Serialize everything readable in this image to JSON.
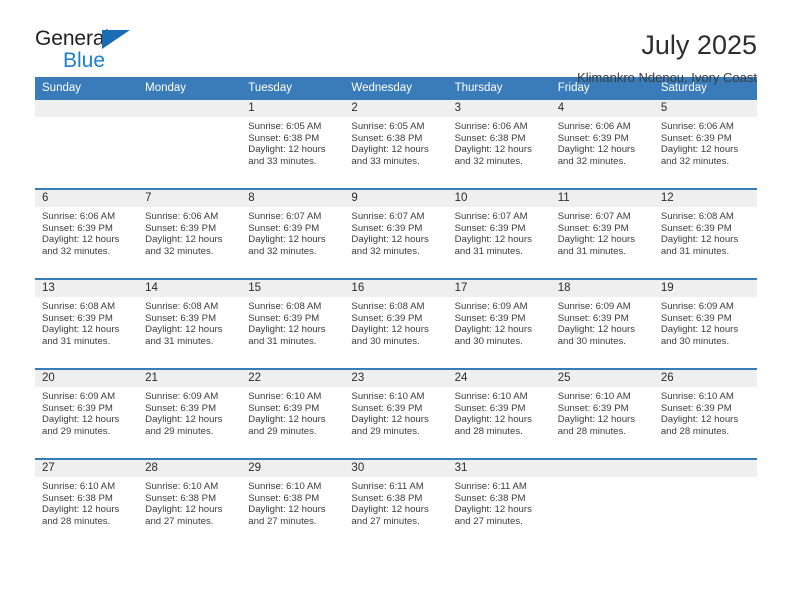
{
  "brand": {
    "name_top": "General",
    "name_bottom": "Blue",
    "accent_color": "#1b7fd4",
    "triangle_color": "#1b6cb5"
  },
  "header": {
    "title": "July 2025",
    "subtitle": "Klimankro Ndenou, Ivory Coast"
  },
  "calendar": {
    "header_bg": "#3a7cba",
    "daynum_bg": "#efefef",
    "weekdays": [
      "Sunday",
      "Monday",
      "Tuesday",
      "Wednesday",
      "Thursday",
      "Friday",
      "Saturday"
    ],
    "weeks": [
      [
        {
          "day": "",
          "sunrise": "",
          "sunset": "",
          "daylight_1": "",
          "daylight_2": ""
        },
        {
          "day": "",
          "sunrise": "",
          "sunset": "",
          "daylight_1": "",
          "daylight_2": ""
        },
        {
          "day": "1",
          "sunrise": "Sunrise: 6:05 AM",
          "sunset": "Sunset: 6:38 PM",
          "daylight_1": "Daylight: 12 hours",
          "daylight_2": "and 33 minutes."
        },
        {
          "day": "2",
          "sunrise": "Sunrise: 6:05 AM",
          "sunset": "Sunset: 6:38 PM",
          "daylight_1": "Daylight: 12 hours",
          "daylight_2": "and 33 minutes."
        },
        {
          "day": "3",
          "sunrise": "Sunrise: 6:06 AM",
          "sunset": "Sunset: 6:38 PM",
          "daylight_1": "Daylight: 12 hours",
          "daylight_2": "and 32 minutes."
        },
        {
          "day": "4",
          "sunrise": "Sunrise: 6:06 AM",
          "sunset": "Sunset: 6:39 PM",
          "daylight_1": "Daylight: 12 hours",
          "daylight_2": "and 32 minutes."
        },
        {
          "day": "5",
          "sunrise": "Sunrise: 6:06 AM",
          "sunset": "Sunset: 6:39 PM",
          "daylight_1": "Daylight: 12 hours",
          "daylight_2": "and 32 minutes."
        }
      ],
      [
        {
          "day": "6",
          "sunrise": "Sunrise: 6:06 AM",
          "sunset": "Sunset: 6:39 PM",
          "daylight_1": "Daylight: 12 hours",
          "daylight_2": "and 32 minutes."
        },
        {
          "day": "7",
          "sunrise": "Sunrise: 6:06 AM",
          "sunset": "Sunset: 6:39 PM",
          "daylight_1": "Daylight: 12 hours",
          "daylight_2": "and 32 minutes."
        },
        {
          "day": "8",
          "sunrise": "Sunrise: 6:07 AM",
          "sunset": "Sunset: 6:39 PM",
          "daylight_1": "Daylight: 12 hours",
          "daylight_2": "and 32 minutes."
        },
        {
          "day": "9",
          "sunrise": "Sunrise: 6:07 AM",
          "sunset": "Sunset: 6:39 PM",
          "daylight_1": "Daylight: 12 hours",
          "daylight_2": "and 32 minutes."
        },
        {
          "day": "10",
          "sunrise": "Sunrise: 6:07 AM",
          "sunset": "Sunset: 6:39 PM",
          "daylight_1": "Daylight: 12 hours",
          "daylight_2": "and 31 minutes."
        },
        {
          "day": "11",
          "sunrise": "Sunrise: 6:07 AM",
          "sunset": "Sunset: 6:39 PM",
          "daylight_1": "Daylight: 12 hours",
          "daylight_2": "and 31 minutes."
        },
        {
          "day": "12",
          "sunrise": "Sunrise: 6:08 AM",
          "sunset": "Sunset: 6:39 PM",
          "daylight_1": "Daylight: 12 hours",
          "daylight_2": "and 31 minutes."
        }
      ],
      [
        {
          "day": "13",
          "sunrise": "Sunrise: 6:08 AM",
          "sunset": "Sunset: 6:39 PM",
          "daylight_1": "Daylight: 12 hours",
          "daylight_2": "and 31 minutes."
        },
        {
          "day": "14",
          "sunrise": "Sunrise: 6:08 AM",
          "sunset": "Sunset: 6:39 PM",
          "daylight_1": "Daylight: 12 hours",
          "daylight_2": "and 31 minutes."
        },
        {
          "day": "15",
          "sunrise": "Sunrise: 6:08 AM",
          "sunset": "Sunset: 6:39 PM",
          "daylight_1": "Daylight: 12 hours",
          "daylight_2": "and 31 minutes."
        },
        {
          "day": "16",
          "sunrise": "Sunrise: 6:08 AM",
          "sunset": "Sunset: 6:39 PM",
          "daylight_1": "Daylight: 12 hours",
          "daylight_2": "and 30 minutes."
        },
        {
          "day": "17",
          "sunrise": "Sunrise: 6:09 AM",
          "sunset": "Sunset: 6:39 PM",
          "daylight_1": "Daylight: 12 hours",
          "daylight_2": "and 30 minutes."
        },
        {
          "day": "18",
          "sunrise": "Sunrise: 6:09 AM",
          "sunset": "Sunset: 6:39 PM",
          "daylight_1": "Daylight: 12 hours",
          "daylight_2": "and 30 minutes."
        },
        {
          "day": "19",
          "sunrise": "Sunrise: 6:09 AM",
          "sunset": "Sunset: 6:39 PM",
          "daylight_1": "Daylight: 12 hours",
          "daylight_2": "and 30 minutes."
        }
      ],
      [
        {
          "day": "20",
          "sunrise": "Sunrise: 6:09 AM",
          "sunset": "Sunset: 6:39 PM",
          "daylight_1": "Daylight: 12 hours",
          "daylight_2": "and 29 minutes."
        },
        {
          "day": "21",
          "sunrise": "Sunrise: 6:09 AM",
          "sunset": "Sunset: 6:39 PM",
          "daylight_1": "Daylight: 12 hours",
          "daylight_2": "and 29 minutes."
        },
        {
          "day": "22",
          "sunrise": "Sunrise: 6:10 AM",
          "sunset": "Sunset: 6:39 PM",
          "daylight_1": "Daylight: 12 hours",
          "daylight_2": "and 29 minutes."
        },
        {
          "day": "23",
          "sunrise": "Sunrise: 6:10 AM",
          "sunset": "Sunset: 6:39 PM",
          "daylight_1": "Daylight: 12 hours",
          "daylight_2": "and 29 minutes."
        },
        {
          "day": "24",
          "sunrise": "Sunrise: 6:10 AM",
          "sunset": "Sunset: 6:39 PM",
          "daylight_1": "Daylight: 12 hours",
          "daylight_2": "and 28 minutes."
        },
        {
          "day": "25",
          "sunrise": "Sunrise: 6:10 AM",
          "sunset": "Sunset: 6:39 PM",
          "daylight_1": "Daylight: 12 hours",
          "daylight_2": "and 28 minutes."
        },
        {
          "day": "26",
          "sunrise": "Sunrise: 6:10 AM",
          "sunset": "Sunset: 6:39 PM",
          "daylight_1": "Daylight: 12 hours",
          "daylight_2": "and 28 minutes."
        }
      ],
      [
        {
          "day": "27",
          "sunrise": "Sunrise: 6:10 AM",
          "sunset": "Sunset: 6:38 PM",
          "daylight_1": "Daylight: 12 hours",
          "daylight_2": "and 28 minutes."
        },
        {
          "day": "28",
          "sunrise": "Sunrise: 6:10 AM",
          "sunset": "Sunset: 6:38 PM",
          "daylight_1": "Daylight: 12 hours",
          "daylight_2": "and 27 minutes."
        },
        {
          "day": "29",
          "sunrise": "Sunrise: 6:10 AM",
          "sunset": "Sunset: 6:38 PM",
          "daylight_1": "Daylight: 12 hours",
          "daylight_2": "and 27 minutes."
        },
        {
          "day": "30",
          "sunrise": "Sunrise: 6:11 AM",
          "sunset": "Sunset: 6:38 PM",
          "daylight_1": "Daylight: 12 hours",
          "daylight_2": "and 27 minutes."
        },
        {
          "day": "31",
          "sunrise": "Sunrise: 6:11 AM",
          "sunset": "Sunset: 6:38 PM",
          "daylight_1": "Daylight: 12 hours",
          "daylight_2": "and 27 minutes."
        },
        {
          "day": "",
          "sunrise": "",
          "sunset": "",
          "daylight_1": "",
          "daylight_2": ""
        },
        {
          "day": "",
          "sunrise": "",
          "sunset": "",
          "daylight_1": "",
          "daylight_2": ""
        }
      ]
    ]
  }
}
